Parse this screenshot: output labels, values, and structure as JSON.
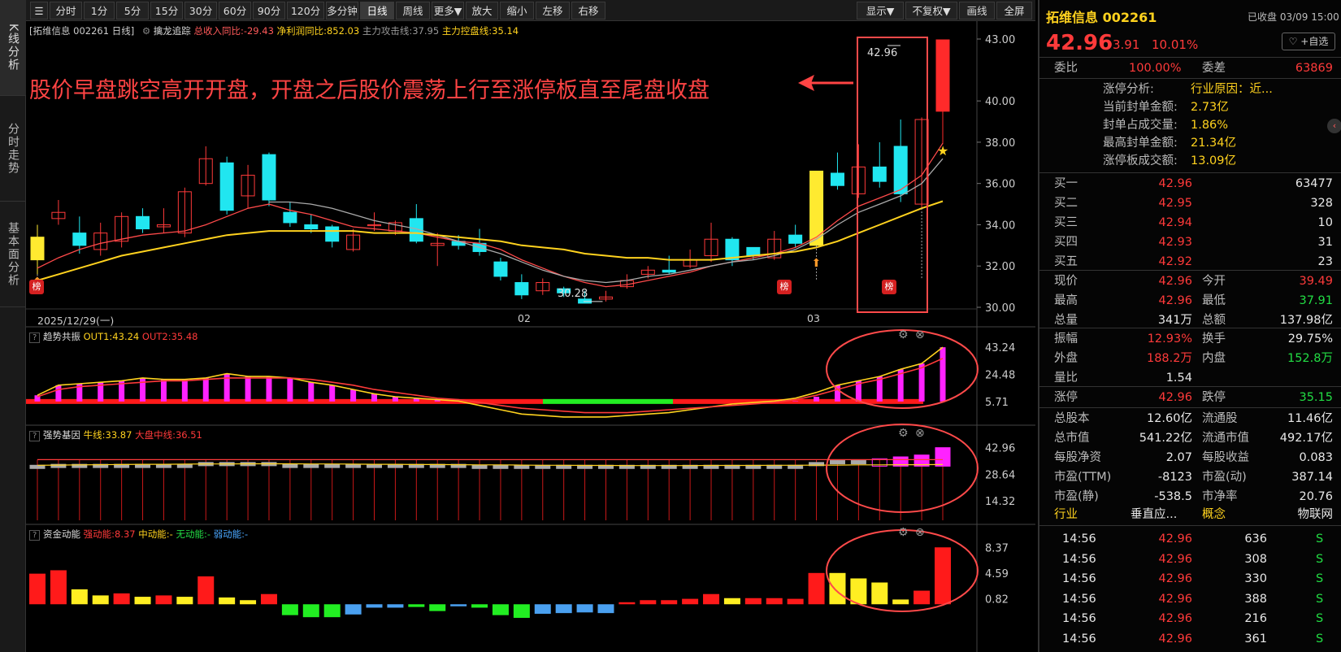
{
  "side_tabs": [
    "K线分析",
    "分时走势",
    "基本面分析"
  ],
  "toolbar": {
    "periods": [
      "分时",
      "1分",
      "5分",
      "15分",
      "30分",
      "60分",
      "90分",
      "120分",
      "多分钟",
      "日线",
      "周线",
      "更多▼"
    ],
    "active": "日线",
    "tools": [
      "放大",
      "缩小",
      "左移",
      "右移"
    ],
    "right_tools": [
      "显示▼",
      "不复权▼",
      "画线",
      "全屏"
    ]
  },
  "main_panel": {
    "title_prefix": "[拓维信息 002261 日线]",
    "indicator_name": "擒龙追踪",
    "metrics": [
      {
        "label": "总收入同比:-29.43",
        "color": "#ff5a5a"
      },
      {
        "label": "净利润同比:852.03",
        "color": "#ffd21e"
      },
      {
        "label": "主力攻击线:37.95",
        "color": "#999999"
      },
      {
        "label": "主力控盘线:35.14",
        "color": "#ffd21e"
      }
    ],
    "annotation": "股价早盘跳空高开开盘，开盘之后股价震荡上行至涨停板直至尾盘收盘",
    "price_label_high": "42.96",
    "price_label_low": "30.28",
    "badge": "榜",
    "dates": [
      "2025/12/29(一)",
      "02",
      "03"
    ]
  },
  "sub1": {
    "name": "趋势共振",
    "out1": "OUT1:43.24",
    "out2": "OUT2:35.48"
  },
  "sub2": {
    "name": "强势基因",
    "niu": "牛线:33.87",
    "dapan": "大盘中线:36.51"
  },
  "sub3": {
    "name": "资金动能",
    "strong": "强动能:8.37",
    "mid": "中动能:-",
    "none": "无动能:-",
    "weak": "弱动能:-"
  },
  "chart_data": [
    {
      "type": "candlestick",
      "title": "擒龙追踪",
      "ylim": [
        30,
        43
      ],
      "y_ticks": [
        "43.00",
        "40.00",
        "38.00",
        "36.00",
        "34.00",
        "32.00",
        "30.00"
      ],
      "candles": [
        [
          33.4,
          32.3,
          34.0,
          31.6
        ],
        [
          34.3,
          34.6,
          35.2,
          34.0
        ],
        [
          33.6,
          33.0,
          34.4,
          32.6
        ],
        [
          32.8,
          33.6,
          34.1,
          32.5
        ],
        [
          33.2,
          34.4,
          34.6,
          32.9
        ],
        [
          34.4,
          33.8,
          34.8,
          33.6
        ],
        [
          33.9,
          34.0,
          34.8,
          33.6
        ],
        [
          33.6,
          35.6,
          35.8,
          33.4
        ],
        [
          36.0,
          37.2,
          37.8,
          35.9
        ],
        [
          37.0,
          34.7,
          37.3,
          34.5
        ],
        [
          35.4,
          36.4,
          36.9,
          34.8
        ],
        [
          37.4,
          35.2,
          37.5,
          34.9
        ],
        [
          34.6,
          34.1,
          35.1,
          33.9
        ],
        [
          34.0,
          33.8,
          34.5,
          33.6
        ],
        [
          33.9,
          33.2,
          34.0,
          32.9
        ],
        [
          32.8,
          33.5,
          33.8,
          32.7
        ],
        [
          34.0,
          34.0,
          34.6,
          33.7
        ],
        [
          33.7,
          34.1,
          34.2,
          33.5
        ],
        [
          34.3,
          33.2,
          35.0,
          33.1
        ],
        [
          33.0,
          33.1,
          33.6,
          32.0
        ],
        [
          33.2,
          33.0,
          33.5,
          32.8
        ],
        [
          33.1,
          32.7,
          33.8,
          32.5
        ],
        [
          32.2,
          31.5,
          32.4,
          31.3
        ],
        [
          31.2,
          30.6,
          31.6,
          30.4
        ],
        [
          30.8,
          31.2,
          31.4,
          30.6
        ],
        [
          30.9,
          30.7,
          31.0,
          30.5
        ],
        [
          30.4,
          30.2,
          30.8,
          30.2
        ],
        [
          30.4,
          30.5,
          30.8,
          30.28
        ],
        [
          31.0,
          31.3,
          31.6,
          30.9
        ],
        [
          31.6,
          31.8,
          32.0,
          31.4
        ],
        [
          31.8,
          31.7,
          32.5,
          31.6
        ],
        [
          32.0,
          32.3,
          32.8,
          31.9
        ],
        [
          32.5,
          33.3,
          34.1,
          32.2
        ],
        [
          33.3,
          32.3,
          33.4,
          32.0
        ],
        [
          32.9,
          32.5,
          32.9,
          32.3
        ],
        [
          32.4,
          33.3,
          33.7,
          32.3
        ],
        [
          33.5,
          33.1,
          34.0,
          32.9
        ],
        [
          33.0,
          36.6,
          36.6,
          33.0
        ],
        [
          36.5,
          35.9,
          37.5,
          35.7
        ],
        [
          35.5,
          36.8,
          37.9,
          35.3
        ],
        [
          36.8,
          36.1,
          38.0,
          35.8
        ],
        [
          37.8,
          35.5,
          39.1,
          35.1
        ],
        [
          35.0,
          39.1,
          39.2,
          34.8
        ],
        [
          39.5,
          42.96,
          42.96,
          37.91
        ]
      ],
      "series": [
        {
          "name": "主力攻击线",
          "color": "#ff4a4a",
          "values": [
            31.9,
            32.4,
            32.8,
            33.1,
            33.3,
            33.5,
            33.6,
            33.7,
            34.0,
            34.4,
            34.8,
            35.0,
            34.7,
            34.5,
            34.2,
            33.9,
            33.8,
            33.7,
            33.6,
            33.4,
            33.2,
            33.1,
            32.8,
            32.3,
            31.9,
            31.5,
            31.2,
            31.0,
            31.1,
            31.3,
            31.5,
            31.7,
            32.0,
            32.2,
            32.4,
            32.6,
            32.9,
            33.4,
            34.2,
            34.9,
            35.3,
            35.7,
            36.4,
            37.95
          ]
        },
        {
          "name": "主力攻击线2",
          "color": "#aaaaaa",
          "values": [
            null,
            null,
            null,
            null,
            null,
            null,
            null,
            null,
            null,
            null,
            null,
            35.1,
            35.1,
            35.0,
            34.8,
            34.5,
            34.2,
            34.0,
            33.8,
            33.5,
            33.2,
            32.9,
            32.6,
            32.2,
            31.8,
            31.5,
            31.3,
            31.2,
            31.3,
            31.5,
            31.6,
            31.8,
            32.0,
            32.2,
            32.3,
            32.5,
            32.8,
            33.3,
            34.0,
            34.6,
            35.0,
            35.4,
            36.0,
            37.2
          ]
        },
        {
          "name": "主力控盘线",
          "color": "#ffd21e",
          "values": [
            31.3,
            31.6,
            31.9,
            32.2,
            32.5,
            32.7,
            32.9,
            33.1,
            33.3,
            33.5,
            33.6,
            33.7,
            33.7,
            33.7,
            33.7,
            33.7,
            33.6,
            33.6,
            33.6,
            33.5,
            33.4,
            33.3,
            33.2,
            33.0,
            32.9,
            32.8,
            32.6,
            32.5,
            32.4,
            32.4,
            32.3,
            32.3,
            32.3,
            32.4,
            32.5,
            32.6,
            32.7,
            32.9,
            33.2,
            33.6,
            34.0,
            34.4,
            34.8,
            35.14
          ]
        }
      ]
    },
    {
      "type": "bar",
      "title": "趋势共振",
      "y_ticks": [
        "43.24",
        "24.48",
        "5.71"
      ],
      "ylim": [
        0,
        45
      ],
      "values": [
        10,
        17,
        18,
        19,
        20,
        22,
        21,
        21,
        22,
        25,
        23,
        23,
        22,
        19,
        17,
        14,
        11,
        9,
        8,
        7,
        6,
        5,
        5,
        4,
        4,
        4,
        4,
        4,
        4,
        4,
        4,
        4,
        4,
        4,
        4,
        5,
        6,
        9,
        17,
        20,
        23,
        28,
        32,
        43.24
      ],
      "series": [
        {
          "name": "OUT1",
          "color": "#ffd21e",
          "values": [
            10,
            17,
            18,
            19,
            20,
            22,
            21,
            21,
            22,
            25,
            23,
            23,
            22,
            19,
            17,
            14,
            11,
            9,
            8,
            7,
            6,
            3,
            0,
            -3,
            -4,
            -5,
            -5,
            -5,
            -4,
            -3,
            -2,
            0,
            2,
            4,
            5,
            6,
            8,
            12,
            17,
            20,
            23,
            28,
            32,
            43.24
          ]
        },
        {
          "name": "OUT2",
          "color": "#ff3a3a",
          "values": [
            9,
            14,
            16,
            17,
            18,
            19,
            20,
            20,
            21,
            22,
            22,
            22,
            22,
            21,
            19,
            17,
            14,
            12,
            10,
            8,
            7,
            5,
            3,
            1,
            0,
            -1,
            -2,
            -2,
            -2,
            -1,
            0,
            1,
            2,
            3,
            4,
            5,
            7,
            10,
            14,
            18,
            21,
            25,
            29,
            35.48
          ]
        }
      ]
    },
    {
      "type": "bar",
      "title": "强势基因",
      "y_ticks": [
        "42.96",
        "28.64",
        "14.32"
      ],
      "ylim": [
        10,
        45
      ],
      "values": [
        33,
        34,
        34,
        34,
        34,
        34,
        34,
        34,
        35,
        35,
        35,
        35,
        34,
        34,
        34,
        34,
        34,
        34,
        34,
        34,
        34,
        33,
        33,
        33,
        33,
        33,
        33,
        33,
        33,
        33,
        33,
        33,
        33,
        33,
        33,
        33,
        33,
        35,
        36,
        36,
        37,
        38,
        39,
        42.96
      ],
      "series": [
        {
          "name": "牛线",
          "color": "#ffd21e",
          "values": [
            33.5,
            33.6,
            33.7,
            33.8,
            33.9,
            34.0,
            34.0,
            34.1,
            34.2,
            34.2,
            34.3,
            34.3,
            34.3,
            34.2,
            34.2,
            34.1,
            34.0,
            34.0,
            33.9,
            33.9,
            33.8,
            33.7,
            33.7,
            33.6,
            33.5,
            33.5,
            33.4,
            33.4,
            33.3,
            33.3,
            33.3,
            33.3,
            33.4,
            33.4,
            33.4,
            33.5,
            33.5,
            33.6,
            33.6,
            33.7,
            33.7,
            33.8,
            33.8,
            33.87
          ]
        },
        {
          "name": "大盘中线",
          "color": "#ff3a3a",
          "values": [
            36.5,
            36.5,
            36.5,
            36.5,
            36.5,
            36.5,
            36.5,
            36.5,
            36.5,
            36.5,
            36.5,
            36.5,
            36.5,
            36.5,
            36.5,
            36.5,
            36.5,
            36.5,
            36.5,
            36.5,
            36.5,
            36.5,
            36.5,
            36.5,
            36.5,
            36.5,
            36.5,
            36.5,
            36.5,
            36.5,
            36.5,
            36.5,
            36.5,
            36.5,
            36.5,
            36.5,
            36.5,
            36.5,
            36.5,
            36.5,
            36.5,
            36.5,
            36.5,
            36.51
          ]
        }
      ]
    },
    {
      "type": "bar",
      "title": "资金动能",
      "y_ticks": [
        "8.37",
        "4.59",
        "0.82"
      ],
      "ylim": [
        -2,
        9
      ],
      "values": [
        4.5,
        5.0,
        2.2,
        1.3,
        1.6,
        1.1,
        1.3,
        1.1,
        4.1,
        1.0,
        0.6,
        1.5,
        -1.6,
        -1.9,
        -1.9,
        -1.5,
        -0.5,
        -0.5,
        -0.4,
        -1.0,
        -0.3,
        -0.5,
        -1.6,
        -2.0,
        -1.4,
        -1.3,
        -1.2,
        -1.3,
        0.3,
        0.6,
        0.6,
        0.8,
        1.5,
        0.9,
        0.9,
        0.9,
        0.8,
        4.6,
        4.6,
        3.8,
        3.2,
        0.7,
        2.0,
        8.37
      ],
      "colors": [
        "red",
        "red",
        "yellow",
        "yellow",
        "red",
        "yellow",
        "red",
        "yellow",
        "red",
        "yellow",
        "yellow",
        "red",
        "green",
        "green",
        "green",
        "blue",
        "blue",
        "blue",
        "green",
        "green",
        "blue",
        "green",
        "green",
        "green",
        "blue",
        "blue",
        "blue",
        "blue",
        "red",
        "red",
        "red",
        "red",
        "red",
        "yellow",
        "red",
        "red",
        "red",
        "red",
        "yellow",
        "yellow",
        "yellow",
        "yellow",
        "red",
        "red"
      ]
    }
  ],
  "quote": {
    "name": "拓维信息 002261",
    "status": "已收盘 03/09 15:00",
    "price": "42.96",
    "change": "3.91",
    "pct": "10.01%",
    "watch_btn": "+自选",
    "weibi_label": "委比",
    "weibi": "100.00%",
    "weicha_label": "委差",
    "weicha": "63869",
    "limit_analysis": [
      {
        "label": "涨停分析:",
        "value": "行业原因：近..."
      },
      {
        "label": "当前封单金额:",
        "value": "2.73亿"
      },
      {
        "label": "封单占成交量:",
        "value": "1.86%"
      },
      {
        "label": "最高封单金额:",
        "value": "21.34亿"
      },
      {
        "label": "涨停板成交额:",
        "value": "13.09亿"
      }
    ],
    "bids": [
      {
        "label": "买一",
        "price": "42.96",
        "vol": "63477"
      },
      {
        "label": "买二",
        "price": "42.95",
        "vol": "328"
      },
      {
        "label": "买三",
        "price": "42.94",
        "vol": "10"
      },
      {
        "label": "买四",
        "price": "42.93",
        "vol": "31"
      },
      {
        "label": "买五",
        "price": "42.92",
        "vol": "23"
      }
    ],
    "stats": [
      [
        {
          "l": "现价",
          "v": "42.96",
          "c": "red"
        },
        {
          "l": "今开",
          "v": "39.49",
          "c": "red"
        }
      ],
      [
        {
          "l": "最高",
          "v": "42.96",
          "c": "red"
        },
        {
          "l": "最低",
          "v": "37.91",
          "c": "green"
        }
      ],
      [
        {
          "l": "总量",
          "v": "341万",
          "c": "white"
        },
        {
          "l": "总额",
          "v": "137.98亿",
          "c": "white"
        }
      ]
    ],
    "stats2": [
      [
        {
          "l": "振幅",
          "v": "12.93%",
          "c": "red"
        },
        {
          "l": "换手",
          "v": "29.75%",
          "c": "white"
        }
      ],
      [
        {
          "l": "外盘",
          "v": "188.2万",
          "c": "red"
        },
        {
          "l": "内盘",
          "v": "152.8万",
          "c": "green"
        }
      ],
      [
        {
          "l": "量比",
          "v": "1.54",
          "c": "white"
        },
        null
      ]
    ],
    "limit_row": [
      {
        "l": "涨停",
        "v": "42.96",
        "c": "red"
      },
      {
        "l": "跌停",
        "v": "35.15",
        "c": "green"
      }
    ],
    "fund": [
      [
        {
          "l": "总股本",
          "v": "12.60亿"
        },
        {
          "l": "流通股",
          "v": "11.46亿"
        }
      ],
      [
        {
          "l": "总市值",
          "v": "541.22亿"
        },
        {
          "l": "流通市值",
          "v": "492.17亿"
        }
      ],
      [
        {
          "l": "每股净资",
          "v": "2.07"
        },
        {
          "l": "每股收益",
          "v": "0.083"
        }
      ],
      [
        {
          "l": "市盈(TTM)",
          "v": "-8123"
        },
        {
          "l": "市盈(动)",
          "v": "387.14"
        }
      ],
      [
        {
          "l": "市盈(静)",
          "v": "-538.5"
        },
        {
          "l": "市净率",
          "v": "20.76"
        }
      ]
    ],
    "industry_label": "行业",
    "industry": "垂直应...",
    "concept_label": "概念",
    "concept": "物联网",
    "ticks": [
      {
        "t": "14:56",
        "p": "42.96",
        "v": "636",
        "s": "S"
      },
      {
        "t": "14:56",
        "p": "42.96",
        "v": "308",
        "s": "S"
      },
      {
        "t": "14:56",
        "p": "42.96",
        "v": "330",
        "s": "S"
      },
      {
        "t": "14:56",
        "p": "42.96",
        "v": "388",
        "s": "S"
      },
      {
        "t": "14:56",
        "p": "42.96",
        "v": "216",
        "s": "S"
      },
      {
        "t": "14:56",
        "p": "42.96",
        "v": "361",
        "s": "S"
      }
    ]
  }
}
